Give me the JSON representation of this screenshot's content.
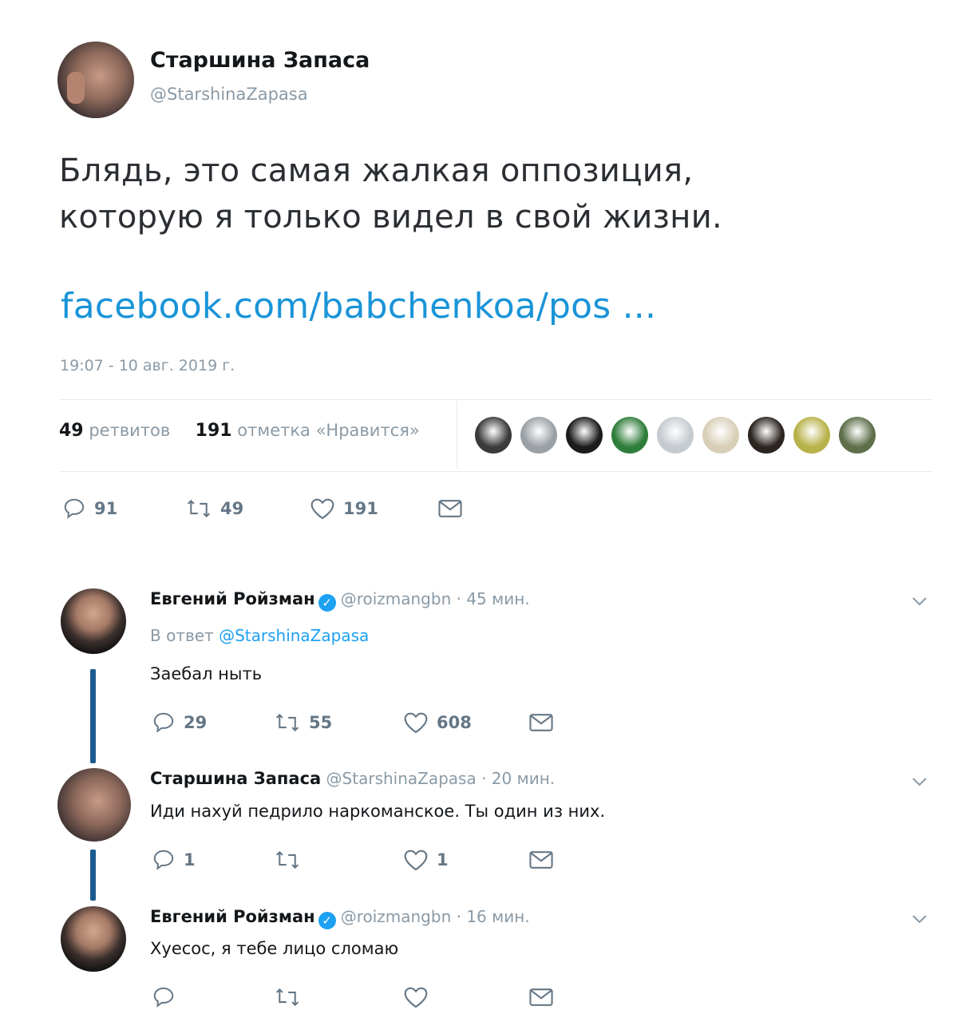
{
  "main_tweet": {
    "author_name": "Старшина Запаса",
    "author_handle": "@StarshinaZapasa",
    "text_line1": "Блядь, это самая жалкая оппозиция,",
    "text_line2": "которую я только видел в свой жизни.",
    "link": "facebook.com/babchenkoa/pos ...",
    "timestamp": "19:07 - 10 авг. 2019 г.",
    "retweets_count": "49",
    "retweets_label": "ретвитов",
    "likes_count": "191",
    "likes_label": "отметка «Нравится»",
    "actions": {
      "replies": "91",
      "retweets": "49",
      "likes": "191"
    },
    "liker_avatar_colors": [
      "#3a3a3a",
      "#9aa0a6",
      "#1c1c1c",
      "#2f7d3a",
      "#c5cbd1",
      "#d9cfb8",
      "#2b2420",
      "#b8b24a",
      "#5e6f4a"
    ]
  },
  "replies": [
    {
      "author_name": "Евгений Ройзман",
      "verified": true,
      "handle_time": "@roizmangbn · 45 мин.",
      "reply_to_label": "В ответ",
      "reply_to_handle": "@StarshinaZapasa",
      "text": "Заебал ныть",
      "actions": {
        "replies": "29",
        "retweets": "55",
        "likes": "608"
      }
    },
    {
      "author_name": "Старшина Запаса",
      "verified": false,
      "handle_time": "@StarshinaZapasa · 20 мин.",
      "text": "Иди нахуй педрило наркоманское. Ты один из них.",
      "actions": {
        "replies": "1",
        "retweets": "",
        "likes": "1"
      }
    },
    {
      "author_name": "Евгений Ройзман",
      "verified": true,
      "handle_time": "@roizmangbn · 16 мин.",
      "text": "Хуесос, я тебе лицо сломаю",
      "actions": {
        "replies": "",
        "retweets": "",
        "likes": ""
      }
    }
  ],
  "colors": {
    "link_blue": "#1a94d8",
    "verified_blue": "#1da1f2",
    "thread_line": "#1b5a8e",
    "muted_text": "#8a9aa6"
  }
}
